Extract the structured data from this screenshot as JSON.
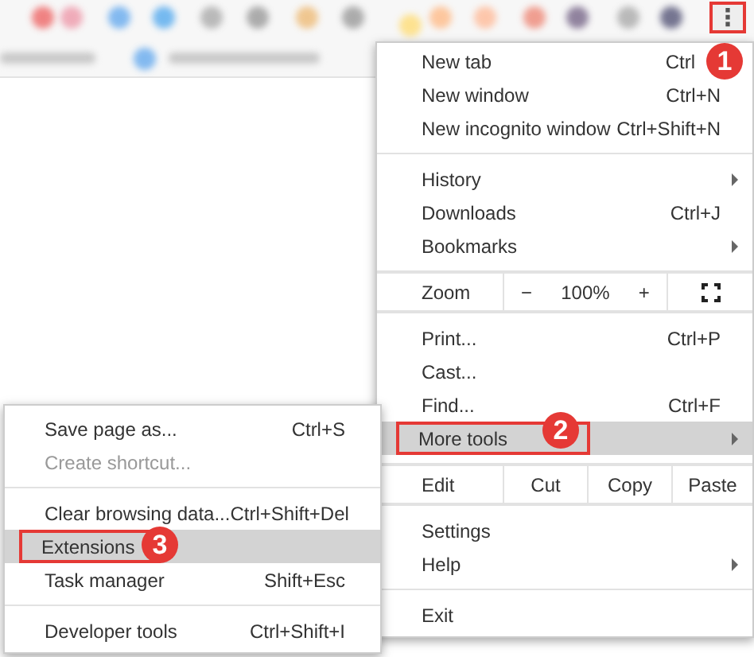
{
  "toolbar": {
    "menu_button": "⋮"
  },
  "menu": {
    "groups": [
      [
        {
          "kind": "item",
          "label": "New tab",
          "shortcut": "Ctrl",
          "submenu": false,
          "highlighted": false,
          "disabled": false
        },
        {
          "kind": "item",
          "label": "New window",
          "shortcut": "Ctrl+N",
          "submenu": false,
          "highlighted": false,
          "disabled": false
        },
        {
          "kind": "item",
          "label": "New incognito window",
          "shortcut": "Ctrl+Shift+N",
          "submenu": false,
          "highlighted": false,
          "disabled": false
        }
      ],
      [
        {
          "kind": "item",
          "label": "History",
          "submenu": true,
          "highlighted": false,
          "disabled": false
        },
        {
          "kind": "item",
          "label": "Downloads",
          "shortcut": "Ctrl+J",
          "submenu": false,
          "highlighted": false,
          "disabled": false
        },
        {
          "kind": "item",
          "label": "Bookmarks",
          "submenu": true,
          "highlighted": false,
          "disabled": false
        }
      ],
      [
        {
          "kind": "zoom",
          "label": "Zoom",
          "minus": "−",
          "value": "100%",
          "plus": "+"
        }
      ],
      [
        {
          "kind": "item",
          "label": "Print...",
          "shortcut": "Ctrl+P",
          "submenu": false,
          "highlighted": false,
          "disabled": false
        },
        {
          "kind": "item",
          "label": "Cast...",
          "submenu": false,
          "highlighted": false,
          "disabled": false
        },
        {
          "kind": "item",
          "label": "Find...",
          "shortcut": "Ctrl+F",
          "submenu": false,
          "highlighted": false,
          "disabled": false
        },
        {
          "kind": "item",
          "label": "More tools",
          "submenu": true,
          "highlighted": true,
          "disabled": false
        }
      ],
      [
        {
          "kind": "edit",
          "label": "Edit",
          "actions": [
            "Cut",
            "Copy",
            "Paste"
          ]
        }
      ],
      [
        {
          "kind": "item",
          "label": "Settings",
          "submenu": false,
          "highlighted": false,
          "disabled": false
        },
        {
          "kind": "item",
          "label": "Help",
          "submenu": true,
          "highlighted": false,
          "disabled": false
        }
      ],
      [
        {
          "kind": "item",
          "label": "Exit",
          "submenu": false,
          "highlighted": false,
          "disabled": false
        }
      ]
    ]
  },
  "submenu": {
    "groups": [
      [
        {
          "kind": "item",
          "label": "Save page as...",
          "shortcut": "Ctrl+S",
          "submenu": false,
          "highlighted": false,
          "disabled": false
        },
        {
          "kind": "item",
          "label": "Create shortcut...",
          "submenu": false,
          "highlighted": false,
          "disabled": true
        }
      ],
      [
        {
          "kind": "item",
          "label": "Clear browsing data...",
          "shortcut": "Ctrl+Shift+Del",
          "submenu": false,
          "highlighted": false,
          "disabled": false
        },
        {
          "kind": "item",
          "label": "Extensions",
          "submenu": false,
          "highlighted": true,
          "disabled": false
        },
        {
          "kind": "item",
          "label": "Task manager",
          "shortcut": "Shift+Esc",
          "submenu": false,
          "highlighted": false,
          "disabled": false
        }
      ],
      [
        {
          "kind": "item",
          "label": "Developer tools",
          "shortcut": "Ctrl+Shift+I",
          "submenu": false,
          "highlighted": false,
          "disabled": false
        }
      ]
    ]
  },
  "annotations": [
    {
      "label": "1"
    },
    {
      "label": "2"
    },
    {
      "label": "3"
    }
  ]
}
